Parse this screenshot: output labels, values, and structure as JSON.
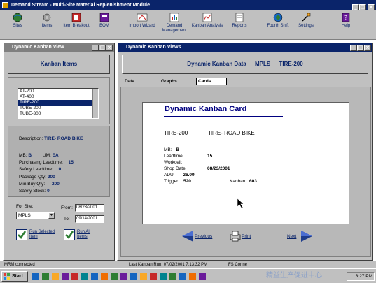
{
  "window": {
    "title": "Demand Stream - Multi-Site Material Replenishment Module"
  },
  "toolbar": {
    "items": [
      {
        "label": "Sites",
        "icon": "globe-icon"
      },
      {
        "label": "Items",
        "icon": "gear-icon"
      },
      {
        "label": "Item Breakout",
        "icon": "breakout-icon"
      },
      {
        "label": "BOM",
        "icon": "bom-icon"
      },
      {
        "label": "Import Wizard",
        "icon": "wizard-icon"
      },
      {
        "label": "Demand Management",
        "icon": "demand-icon"
      },
      {
        "label": "Kanban Analysis",
        "icon": "kanban-icon"
      },
      {
        "label": "Reports",
        "icon": "reports-icon"
      },
      {
        "label": "Fourth Shift",
        "icon": "fourth-shift-icon"
      },
      {
        "label": "Settings",
        "icon": "settings-icon"
      },
      {
        "label": "Help",
        "icon": "help-icon"
      }
    ]
  },
  "left_window": {
    "title": "Dynamic Kanban View",
    "header": "Kanban Items",
    "list": [
      "AT-200",
      "AT-400",
      "TIRE-200",
      "TUBE-200",
      "TUBE-300"
    ],
    "selected_index": 2,
    "description_label": "Description:",
    "description_value": "TIRE- ROAD BIKE",
    "mb_label": "MB:",
    "mb_value": "B",
    "um_label": "UM:",
    "um_value": "EA",
    "purchasing_label": "Purchasing Leadtime:",
    "purchasing_value": "15",
    "safety_label": "Safety Leadtime:",
    "safety_value": "0",
    "package_label": "Package Qty:",
    "package_value": "200",
    "minbuy_label": "Min Buy Qty:",
    "minbuy_value": "200",
    "safetystock_label": "Safety Stock:",
    "safetystock_value": "0",
    "for_site_label": "For Site:",
    "site_value": "MPLS",
    "from_label": "From:",
    "from_value": "08/23/2001",
    "to_label": "To:",
    "to_value": "09/14/2001",
    "run_selected_label": "Run Selected Item",
    "run_all_label": "Run All Items"
  },
  "right_window": {
    "title": "Dynamic Kanban Views",
    "header_title": "Dynamic Kanban Data",
    "header_site": "MPLS",
    "header_item": "TIRE-200",
    "tabs": [
      "Data",
      "Graphs",
      "Cards"
    ],
    "active_tab": "Cards",
    "card": {
      "title": "Dynamic Kanban Card",
      "item": "TIRE-200",
      "description": "TIRE- ROAD BIKE",
      "mb_label": "MB:",
      "mb_value": "B",
      "leadtime_label": "Leadtime:",
      "leadtime_value": "15",
      "workcell_label": "Workcell:",
      "workcell_value": "",
      "shopdate_label": "Shop Date:",
      "shopdate_value": "08/23/2001",
      "adu_label": "ADU:",
      "adu_value": "26.09",
      "trigger_label": "Trigger:",
      "trigger_value": "520",
      "kanban_label": "Kanban:",
      "kanban_value": "603"
    },
    "nav": {
      "previous": "Previous",
      "print": "Print",
      "next": "Next"
    }
  },
  "status": {
    "connection": "MRM connected",
    "last_run": "Last Kanban Run: 07/02/2001 7:13:32 PM",
    "fs_conn": "FS Conne"
  },
  "taskbar": {
    "start_label": "Start",
    "clock": "3:27 PM",
    "watermark": "精益生产促进中心"
  },
  "colors": {
    "title_blue": "#0a246a",
    "face": "#c0c0c0",
    "dark_blue": "#000080"
  }
}
